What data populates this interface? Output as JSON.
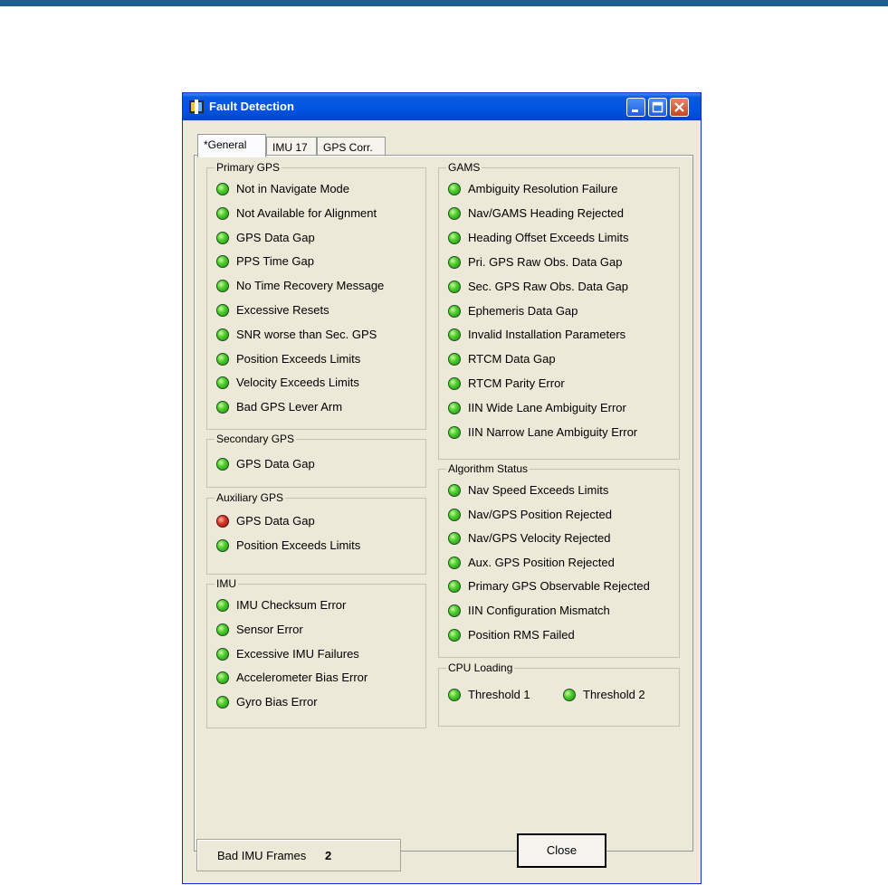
{
  "window": {
    "title": "Fault Detection"
  },
  "tabs": [
    {
      "label": "*General",
      "active": true
    },
    {
      "label": "IMU 17",
      "active": false
    },
    {
      "label": "GPS Corr.",
      "active": false
    }
  ],
  "status_colors": {
    "ok": "#3cc21f",
    "fault": "#d83a2c"
  },
  "groups": {
    "primary_gps": {
      "title": "Primary GPS",
      "items": [
        {
          "label": "Not in Navigate Mode",
          "status": "ok"
        },
        {
          "label": "Not Available for Alignment",
          "status": "ok"
        },
        {
          "label": "GPS Data Gap",
          "status": "ok"
        },
        {
          "label": "PPS Time Gap",
          "status": "ok"
        },
        {
          "label": "No Time Recovery Message",
          "status": "ok"
        },
        {
          "label": "Excessive Resets",
          "status": "ok"
        },
        {
          "label": "SNR worse than Sec. GPS",
          "status": "ok"
        },
        {
          "label": "Position Exceeds Limits",
          "status": "ok"
        },
        {
          "label": "Velocity Exceeds Limits",
          "status": "ok"
        },
        {
          "label": "Bad GPS Lever Arm",
          "status": "ok"
        }
      ]
    },
    "secondary_gps": {
      "title": "Secondary GPS",
      "items": [
        {
          "label": "GPS Data Gap",
          "status": "ok"
        }
      ]
    },
    "auxiliary_gps": {
      "title": "Auxiliary GPS",
      "items": [
        {
          "label": "GPS Data Gap",
          "status": "fault"
        },
        {
          "label": "Position Exceeds Limits",
          "status": "ok"
        }
      ]
    },
    "imu": {
      "title": "IMU",
      "items": [
        {
          "label": "IMU Checksum Error",
          "status": "ok"
        },
        {
          "label": "Sensor Error",
          "status": "ok"
        },
        {
          "label": "Excessive IMU Failures",
          "status": "ok"
        },
        {
          "label": "Accelerometer Bias Error",
          "status": "ok"
        },
        {
          "label": "Gyro Bias Error",
          "status": "ok"
        }
      ]
    },
    "gams": {
      "title": "GAMS",
      "items": [
        {
          "label": "Ambiguity Resolution Failure",
          "status": "ok"
        },
        {
          "label": "Nav/GAMS Heading Rejected",
          "status": "ok"
        },
        {
          "label": "Heading Offset Exceeds Limits",
          "status": "ok"
        },
        {
          "label": "Pri. GPS Raw Obs. Data Gap",
          "status": "ok"
        },
        {
          "label": "Sec. GPS Raw Obs. Data Gap",
          "status": "ok"
        },
        {
          "label": "Ephemeris Data Gap",
          "status": "ok"
        },
        {
          "label": "Invalid Installation Parameters",
          "status": "ok"
        },
        {
          "label": "RTCM Data Gap",
          "status": "ok"
        },
        {
          "label": "RTCM Parity Error",
          "status": "ok"
        },
        {
          "label": "IIN Wide Lane Ambiguity Error",
          "status": "ok"
        },
        {
          "label": "IIN Narrow Lane Ambiguity Error",
          "status": "ok"
        }
      ]
    },
    "algorithm_status": {
      "title": "Algorithm Status",
      "items": [
        {
          "label": "Nav Speed Exceeds Limits",
          "status": "ok"
        },
        {
          "label": "Nav/GPS Position Rejected",
          "status": "ok"
        },
        {
          "label": "Nav/GPS Velocity Rejected",
          "status": "ok"
        },
        {
          "label": "Aux. GPS Position Rejected",
          "status": "ok"
        },
        {
          "label": "Primary GPS Observable Rejected",
          "status": "ok"
        },
        {
          "label": "IIN Configuration Mismatch",
          "status": "ok"
        },
        {
          "label": "Position RMS Failed",
          "status": "ok"
        }
      ]
    },
    "cpu_loading": {
      "title": "CPU Loading",
      "items": [
        {
          "label": "Threshold 1",
          "status": "ok"
        },
        {
          "label": "Threshold 2",
          "status": "ok"
        }
      ]
    }
  },
  "footer": {
    "bad_imu_frames_label": "Bad IMU Frames",
    "bad_imu_frames_value": "2",
    "close_label": "Close"
  }
}
